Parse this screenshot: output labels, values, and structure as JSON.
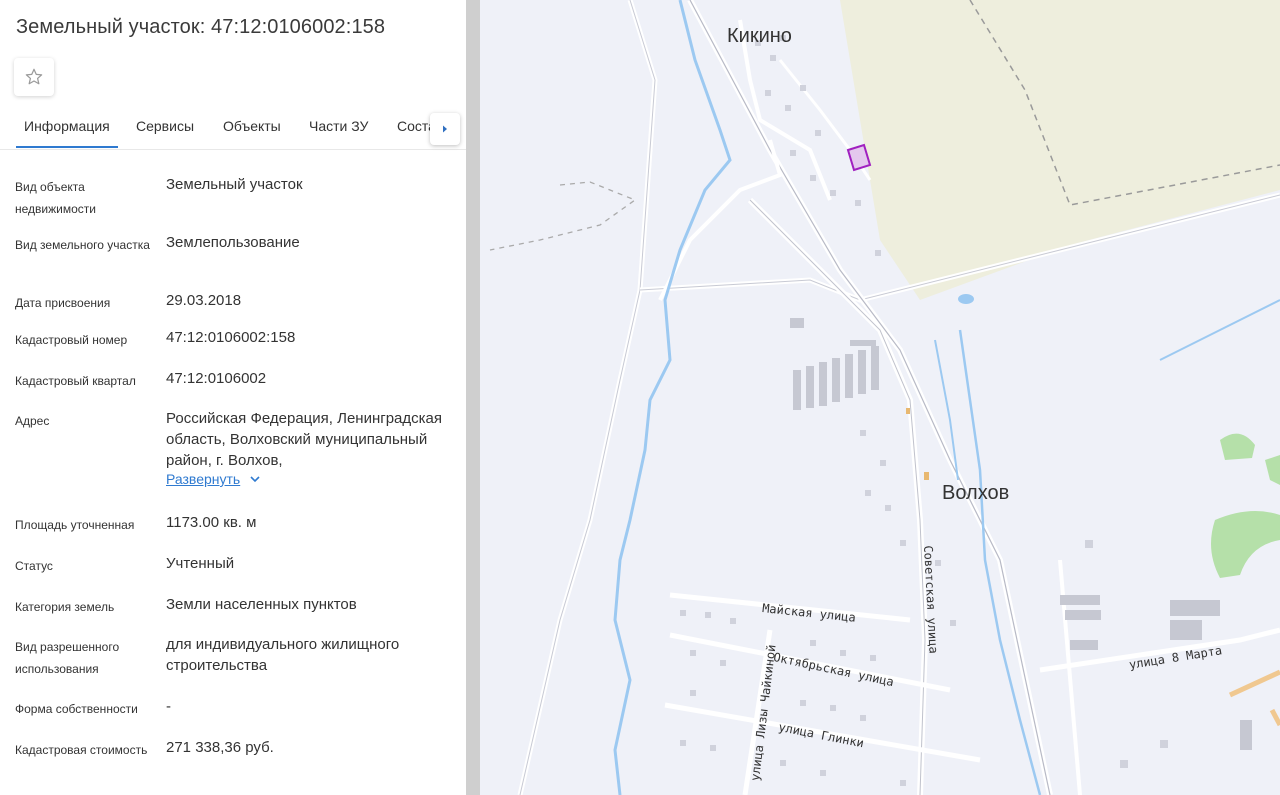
{
  "title": "Земельный участок: 47:12:0106002:158",
  "favorite_icon": "star-outline-icon",
  "tabs": [
    {
      "label": "Информация",
      "active": true
    },
    {
      "label": "Сервисы",
      "active": false
    },
    {
      "label": "Объекты",
      "active": false
    },
    {
      "label": "Части ЗУ",
      "active": false
    },
    {
      "label": "Соста",
      "active": false
    }
  ],
  "tab_scroll_icon": "chevron-right-icon",
  "rows": [
    {
      "label": "Вид объекта недвижимости",
      "value": "Земельный участок"
    },
    {
      "label": "Вид земельного участка",
      "value": "Землепользование"
    },
    {
      "label": "Дата присвоения",
      "value": "29.03.2018"
    },
    {
      "label": "Кадастровый номер",
      "value": "47:12:0106002:158"
    },
    {
      "label": "Кадастровый квартал",
      "value": "47:12:0106002"
    },
    {
      "label": "Адрес",
      "value": "Российская Федерация, Ленинградская область, Волховский муниципальный район, г. Волхов,"
    },
    {
      "label": "Площадь уточненная",
      "value": "1173.00 кв. м"
    },
    {
      "label": "Статус",
      "value": "Учтенный"
    },
    {
      "label": "Категория земель",
      "value": "Земли населенных пунктов"
    },
    {
      "label": "Вид разрешенного использования",
      "value": "для индивидуального жилищного строительства"
    },
    {
      "label": "Форма собственности",
      "value": "-"
    },
    {
      "label": "Кадастровая стоимость",
      "value": "271 338,36 руб."
    }
  ],
  "expand_label": "Развернуть",
  "expand_icon": "chevron-down-icon",
  "map": {
    "places": [
      "Кикино",
      "Волхов"
    ],
    "streets": [
      "Майская улица",
      "Октябрьская улица",
      "улица Глинки",
      "улица Лизы Чайкиной",
      "Советская улица",
      "улица 8 Марта"
    ],
    "colors": {
      "background": "#eff1f8",
      "field": "#eeeedd",
      "water": "#9cc9f1",
      "forest": "#b5e0a9",
      "parcel": "#a020c0"
    }
  }
}
